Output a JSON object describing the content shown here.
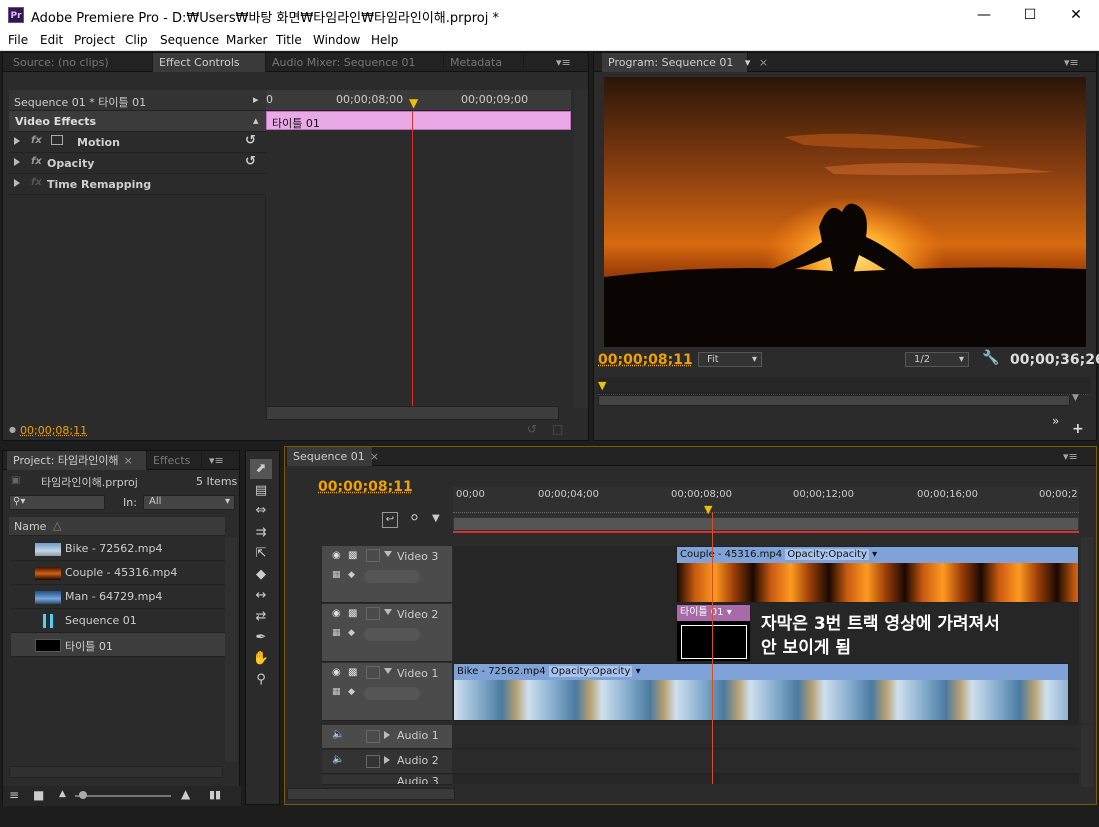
{
  "window": {
    "title": "Adobe Premiere Pro - D:₩Users₩바탕 화면₩타임라인₩타임라인이해.prproj *",
    "app_icon": "Pr"
  },
  "menu": [
    "File",
    "Edit",
    "Project",
    "Clip",
    "Sequence",
    "Marker",
    "Title",
    "Window",
    "Help"
  ],
  "source_panel": {
    "tabs": [
      "Source: (no clips)",
      "Effect Controls",
      "Audio Mixer: Sequence 01",
      "Metadata"
    ],
    "active": 1
  },
  "effect_controls": {
    "clip_label": "Sequence 01 * 타이틀 01",
    "ruler_labels": [
      "0",
      "00;00;08;00",
      "00;00;09;00"
    ],
    "clip_bar": "타이틀 01",
    "section": "Video Effects",
    "effects": [
      "Motion",
      "Opacity",
      "Time Remapping"
    ],
    "timecode": "00;00;08;11"
  },
  "program": {
    "tab": "Program: Sequence 01",
    "timecode": "00;00;08;11",
    "fit": "Fit",
    "res": "1/2",
    "duration": "00;00;36;26"
  },
  "project": {
    "tabs": [
      "Project: 타임라인이해",
      "Effects"
    ],
    "filename": "타임라인이해.prproj",
    "count": "5 Items",
    "in_label": "In:",
    "in_value": "All",
    "column": "Name",
    "items": [
      {
        "name": "Bike - 72562.mp4",
        "thumb": "sky"
      },
      {
        "name": "Couple - 45316.mp4",
        "thumb": "sunset"
      },
      {
        "name": "Man - 64729.mp4",
        "thumb": "blue"
      },
      {
        "name": "Sequence 01",
        "thumb": "seq"
      },
      {
        "name": "타이틀 01",
        "thumb": "title"
      }
    ]
  },
  "sequence": {
    "tab": "Sequence 01",
    "timecode": "00;00;08;11",
    "ruler_labels": [
      "00;00",
      "00;00;04;00",
      "00;00;08;00",
      "00;00;12;00",
      "00;00;16;00",
      "00;00;2"
    ],
    "tracks": [
      "Video 3",
      "Video 2",
      "Video 1",
      "Audio 1",
      "Audio 2",
      "Audio 3"
    ],
    "clips": {
      "couple": "Couple - 45316.mp4",
      "couple_fx": "Opacity:Opacity",
      "title": "타이틀 01",
      "bike": "Bike - 72562.mp4",
      "bike_fx": "Opacity:Opacity"
    },
    "annotation": [
      "자막은 3번 트랙 영상에 가려져서",
      "안 보이게 됨"
    ]
  }
}
